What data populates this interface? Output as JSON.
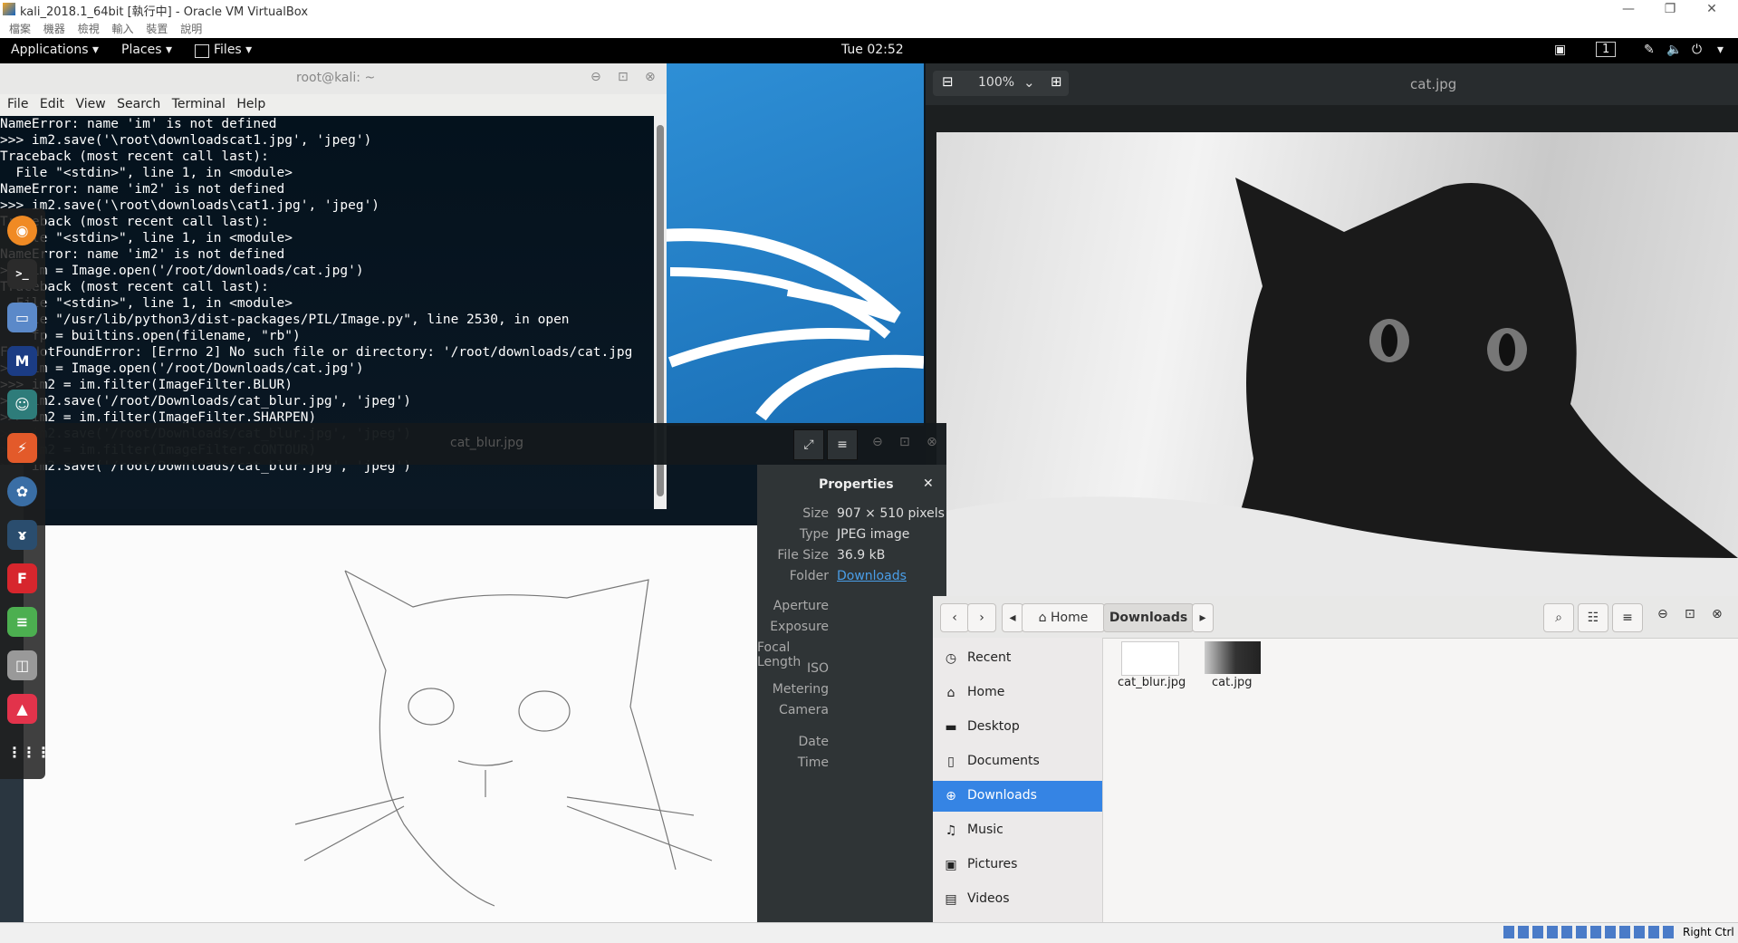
{
  "vbox": {
    "title": "kali_2018.1_64bit [執行中] - Oracle VM VirtualBox",
    "menu": [
      "檔案",
      "機器",
      "檢視",
      "輸入",
      "裝置",
      "說明"
    ],
    "host_key": "Right Ctrl"
  },
  "topbar": {
    "applications": "Applications ▾",
    "places": "Places ▾",
    "files": "Files ▾",
    "clock": "Tue 02:52",
    "workspace": "1"
  },
  "terminal": {
    "title": "root@kali: ~",
    "menu": [
      "File",
      "Edit",
      "View",
      "Search",
      "Terminal",
      "Help"
    ],
    "lines": [
      "NameError: name 'im' is not defined",
      ">>> im2.save('\\root\\downloadscat1.jpg', 'jpeg')",
      "Traceback (most recent call last):",
      "  File \"<stdin>\", line 1, in <module>",
      "NameError: name 'im2' is not defined",
      ">>> im2.save('\\root\\downloads\\cat1.jpg', 'jpeg')",
      "Traceback (most recent call last):",
      "  File \"<stdin>\", line 1, in <module>",
      "NameError: name 'im2' is not defined",
      ">>> im = Image.open('/root/downloads/cat.jpg')",
      "Traceback (most recent call last):",
      "  File \"<stdin>\", line 1, in <module>",
      "  File \"/usr/lib/python3/dist-packages/PIL/Image.py\", line 2530, in open",
      "    fp = builtins.open(filename, \"rb\")",
      "FileNotFoundError: [Errno 2] No such file or directory: '/root/downloads/cat.jpg",
      "",
      ">>> im = Image.open('/root/Downloads/cat.jpg')",
      ">>> im2 = im.filter(ImageFilter.BLUR)",
      ">>> im2.save('/root/Downloads/cat_blur.jpg', 'jpeg')",
      ">>> im2 = im.filter(ImageFilter.SHARPEN)",
      ">>> im2.save('/root/Downloads/cat_blur.jpg', 'jpeg')",
      ">>> im2 = im.filter(ImageFilter.CONTOUR)",
      ">>> im2.save('/root/Downloads/cat_blur.jpg', 'jpeg')",
      ">>> "
    ]
  },
  "blur_viewer": {
    "title": "cat_blur.jpg",
    "properties": {
      "heading": "Properties",
      "rows": [
        {
          "label": "Size",
          "value": "907 × 510 pixels"
        },
        {
          "label": "Type",
          "value": "JPEG image"
        },
        {
          "label": "File Size",
          "value": "36.9 kB"
        },
        {
          "label": "Folder",
          "value": "Downloads"
        },
        {
          "label": "Aperture",
          "value": ""
        },
        {
          "label": "Exposure",
          "value": ""
        },
        {
          "label": "Focal Length",
          "value": ""
        },
        {
          "label": "ISO",
          "value": ""
        },
        {
          "label": "Metering",
          "value": ""
        },
        {
          "label": "Camera",
          "value": ""
        },
        {
          "label": "Date",
          "value": ""
        },
        {
          "label": "Time",
          "value": ""
        }
      ]
    }
  },
  "cat_viewer": {
    "title": "cat.jpg",
    "zoom": "100%"
  },
  "files": {
    "path_home": "Home",
    "path_current": "Downloads",
    "sidebar": [
      {
        "icon": "◷",
        "label": "Recent"
      },
      {
        "icon": "⌂",
        "label": "Home"
      },
      {
        "icon": "▬",
        "label": "Desktop"
      },
      {
        "icon": "▯",
        "label": "Documents"
      },
      {
        "icon": "⊕",
        "label": "Downloads"
      },
      {
        "icon": "♫",
        "label": "Music"
      },
      {
        "icon": "▣",
        "label": "Pictures"
      },
      {
        "icon": "▤",
        "label": "Videos"
      }
    ],
    "items": [
      {
        "name": "cat_blur.jpg"
      },
      {
        "name": "cat.jpg"
      }
    ]
  }
}
